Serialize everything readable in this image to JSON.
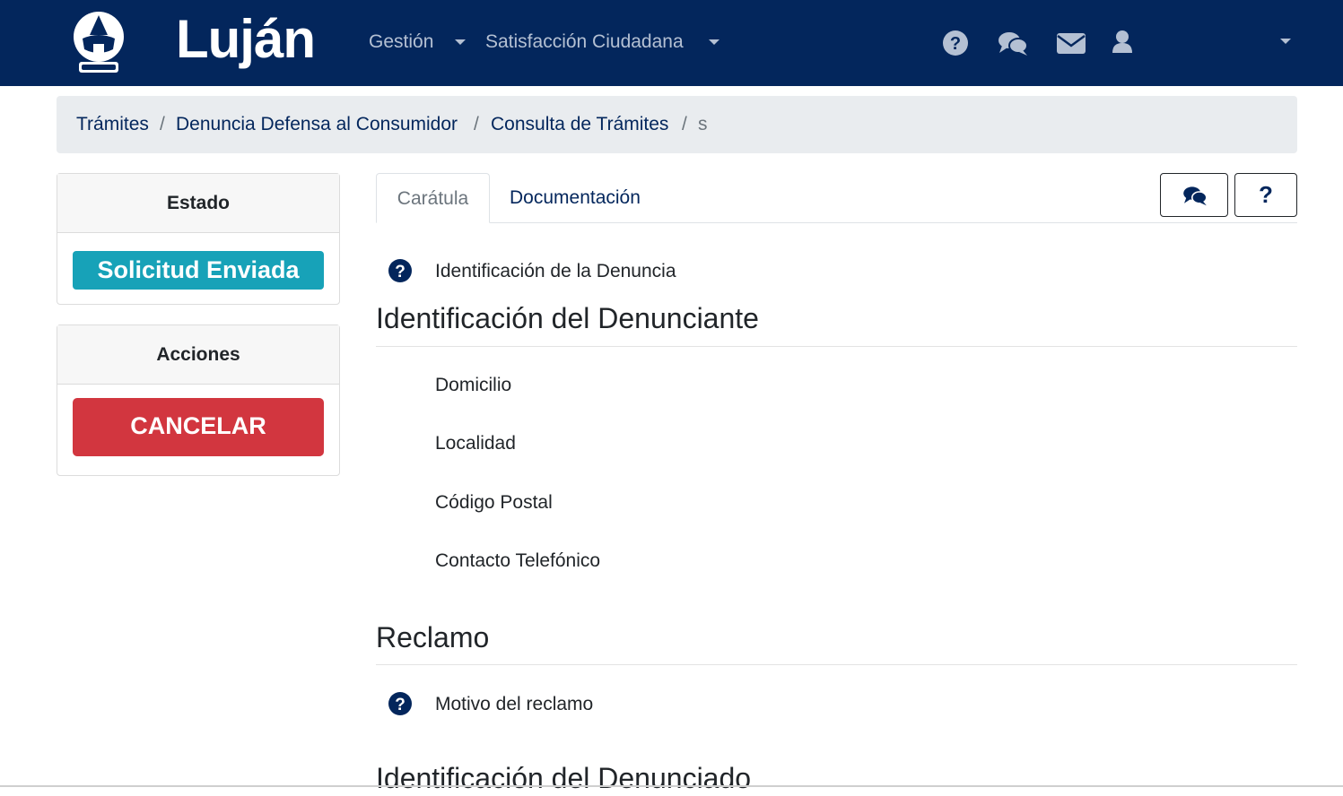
{
  "navbar": {
    "brand": "Luján",
    "menu": [
      {
        "label": "Gestión"
      },
      {
        "label": "Satisfacción Ciudadana"
      }
    ],
    "icons": [
      "question-circle-icon",
      "comments-icon",
      "envelope-icon",
      "user-icon"
    ],
    "bg_color": "#03265c"
  },
  "breadcrumb": {
    "items": [
      "Trámites",
      "Denuncia Defensa al Consumidor",
      "Consulta de Trámites"
    ],
    "active": "s",
    "separator": "/"
  },
  "sidebar": {
    "estado": {
      "header": "Estado",
      "badge": "Solicitud Enviada",
      "badge_color": "#17a2b8"
    },
    "acciones": {
      "header": "Acciones",
      "cancel_label": "CANCELAR",
      "cancel_color": "#d2363f"
    }
  },
  "tabs": [
    {
      "label": "Carátula",
      "active": true
    },
    {
      "label": "Documentación",
      "active": false
    }
  ],
  "toolbar": {
    "icons": [
      "comments-icon",
      "question-icon"
    ]
  },
  "content": {
    "denuncia_field": "Identificación de la Denuncia",
    "sections": [
      {
        "title": "Identificación del Denunciante",
        "fields": [
          "Domicilio",
          "Localidad",
          "Código Postal",
          "Contacto Telefónico"
        ]
      },
      {
        "title": "Reclamo",
        "fields": [
          "Motivo del reclamo"
        ]
      },
      {
        "title": "Identificación del Denunciado",
        "fields": []
      }
    ]
  }
}
